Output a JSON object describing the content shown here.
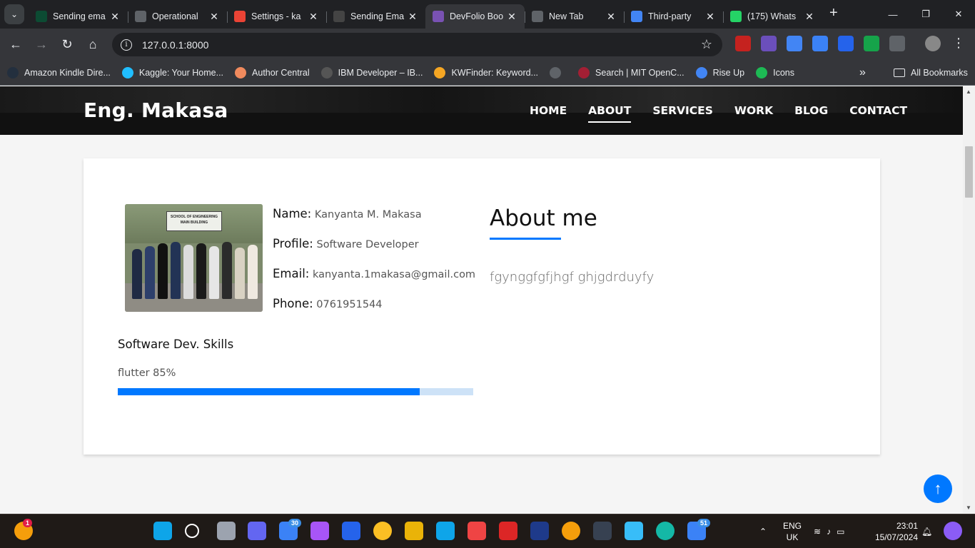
{
  "browser": {
    "tabs": [
      {
        "title": "Sending ema",
        "favicon": "django-icon",
        "color": "#0c4b33",
        "active": false
      },
      {
        "title": "Operational",
        "favicon": "globe-icon",
        "color": "#5f6368",
        "active": false
      },
      {
        "title": "Settings - ka",
        "favicon": "gmail-icon",
        "color": "#ea4335",
        "active": false
      },
      {
        "title": "Sending Ema",
        "favicon": "openai-icon",
        "color": "#444",
        "active": false
      },
      {
        "title": "DevFolio Boo",
        "favicon": "bootstrap-icon",
        "color": "#7952b3",
        "active": true
      },
      {
        "title": "New Tab",
        "favicon": "chrome-icon",
        "color": "#5f6368",
        "active": false
      },
      {
        "title": "Third-party",
        "favicon": "google-icon",
        "color": "#4285f4",
        "active": false
      },
      {
        "title": "(175) Whats",
        "favicon": "whatsapp-icon",
        "color": "#25d366",
        "active": false
      }
    ],
    "url": "127.0.0.1:8000",
    "bookmarks": [
      {
        "label": "Amazon Kindle Dire...",
        "icon": "amazon-icon",
        "color": "#232f3e"
      },
      {
        "label": "Kaggle: Your Home...",
        "icon": "kaggle-icon",
        "color": "#20beff"
      },
      {
        "label": "Author Central",
        "icon": "author-central-icon",
        "color": "#f08a5d"
      },
      {
        "label": "IBM Developer – IB...",
        "icon": "ibm-icon",
        "color": "#555"
      },
      {
        "label": "KWFinder: Keyword...",
        "icon": "kwfinder-icon",
        "color": "#f5a623"
      },
      {
        "label": "",
        "icon": "globe-icon",
        "color": "#5f6368"
      },
      {
        "label": "Search | MIT OpenC...",
        "icon": "mit-ocw-icon",
        "color": "#a31f34"
      },
      {
        "label": "Rise Up",
        "icon": "google-icon",
        "color": "#4285f4"
      },
      {
        "label": "Icons",
        "icon": "icons-app-icon",
        "color": "#1db954"
      }
    ],
    "all_bookmarks": "All Bookmarks"
  },
  "site": {
    "brand": "Eng. Makasa",
    "nav": [
      "HOME",
      "ABOUT",
      "SERVICES",
      "WORK",
      "BLOG",
      "CONTACT"
    ],
    "active_nav": "ABOUT"
  },
  "profile": {
    "photo_sign": "SCHOOL OF ENGINEERING MAIN BUILDING",
    "name_label": "Name:",
    "name": "Kanyanta M. Makasa",
    "profile_label": "Profile:",
    "profile": "Software Developer",
    "email_label": "Email:",
    "email": "kanyanta.1makasa@gmail.com",
    "phone_label": "Phone:",
    "phone": "0761951544"
  },
  "skills": {
    "title": "Software Dev. Skills",
    "items": [
      {
        "label": "flutter 85%",
        "percent": 85
      }
    ]
  },
  "about": {
    "title": "About me",
    "text": "fgynggfgfjhgf ghjgdrduyfy"
  },
  "taskbar": {
    "language": "ENG",
    "region": "UK",
    "time": "23:01",
    "date": "15/07/2024",
    "mail_badge": "30",
    "todo_badge": "51",
    "weather_badge": "1"
  },
  "colors": {
    "accent": "#0078ff",
    "progress_track": "#cde2f7"
  }
}
